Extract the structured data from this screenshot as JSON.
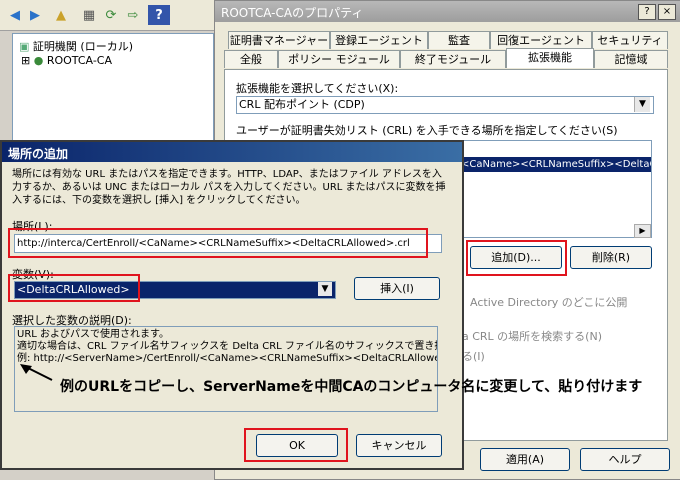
{
  "tree": {
    "root_label": "証明機関 (ローカル)",
    "child_label": "ROOTCA-CA",
    "expander": "⊞"
  },
  "props": {
    "title": "ROOTCA-CAのプロパティ",
    "help_btn": "?",
    "close_btn": "×",
    "tabs_row1": [
      "証明書マネージャー",
      "登録エージェント",
      "監査",
      "回復エージェント",
      "セキュリティ"
    ],
    "tabs_row2": [
      "全般",
      "ポリシー モジュール",
      "終了モジュール",
      "拡張機能",
      "記憶域"
    ],
    "ext_select_label": "拡張機能を選択してください(X):",
    "ext_select_value": "CRL 配布ポイント (CDP)",
    "user_desc": "ユーザーが証明書失効リスト (CRL) を入手できる場所を指定してください(S)",
    "list_item": "<CaName><CRLNameSuffix><DeltaC",
    "add_button": "追加(D)...",
    "remove_button": "削除(R)",
    "ad_text": "Active Directory のどこに公開",
    "crl_text": "a CRL の場所を検索する(N)",
    "crl_text2": "る(I)",
    "apply_button": "適用(A)",
    "help_button": "ヘルプ"
  },
  "dialog": {
    "title": "場所の追加",
    "desc": "場所には有効な URL またはパスを指定できます。HTTP、LDAP、またはファイル アドレスを入力するか、あるいは UNC またはローカル パスを入力してください。URL またはパスに変数を挿入するには、下の変数を選択し [挿入] をクリックしてください。",
    "location_label": "場所(L):",
    "location_value": "http://interca/CertEnroll/<CaName><CRLNameSuffix><DeltaCRLAllowed>.crl",
    "variable_label": "変数(V):",
    "variable_value": "<DeltaCRLAllowed>",
    "insert_button": "挿入(I)",
    "desc_label": "選択した変数の説明(D):",
    "desc_line1": "URL およびパスで使用されます。",
    "desc_line2": "適切な場合は、CRL ファイル名サフィックスを Delta CRL ファイル名のサフィックスで置き換え",
    "desc_line3": "例: http://<ServerName>/CertEnroll/<CaName><CRLNameSuffix><DeltaCRLAllowed",
    "ok_button": "OK",
    "cancel_button": "キャンセル"
  },
  "annotation": "例のURLをコピーし、ServerNameを中間CAのコンピュータ名に変更して、貼り付けます",
  "colors": {
    "highlight": "#e0141e",
    "selection": "#0a246a"
  }
}
